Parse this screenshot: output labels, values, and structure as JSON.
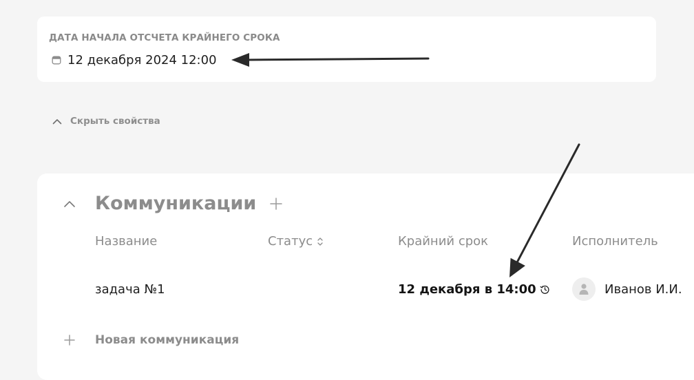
{
  "properties": {
    "deadline_start_label": "ДАТА НАЧАЛА ОТСЧЕТА КРАЙНЕГО СРОКА",
    "deadline_start_value": "12 декабря 2024 12:00",
    "date_icon": "calendar-icon",
    "hide_properties_label": "Скрыть свойства"
  },
  "communications": {
    "title": "Коммуникации",
    "columns": [
      {
        "label": "Название"
      },
      {
        "label": "Статус",
        "sortable": true
      },
      {
        "label": "Крайний срок"
      },
      {
        "label": "Исполнитель"
      }
    ],
    "rows": [
      {
        "name": "задача №1",
        "status": "",
        "deadline": "12 декабря в 14:00",
        "deadline_icon": "history-icon",
        "assignee": "Иванов И.И.",
        "assignee_icon": "user-avatar-icon"
      }
    ],
    "new_label": "Новая коммуникация"
  },
  "colors": {
    "background": "#f5f5f5",
    "card": "#ffffff",
    "muted_text": "#8c8c8c",
    "primary_text": "#1f1f1f",
    "annotation_arrow": "#2a2a2a"
  }
}
